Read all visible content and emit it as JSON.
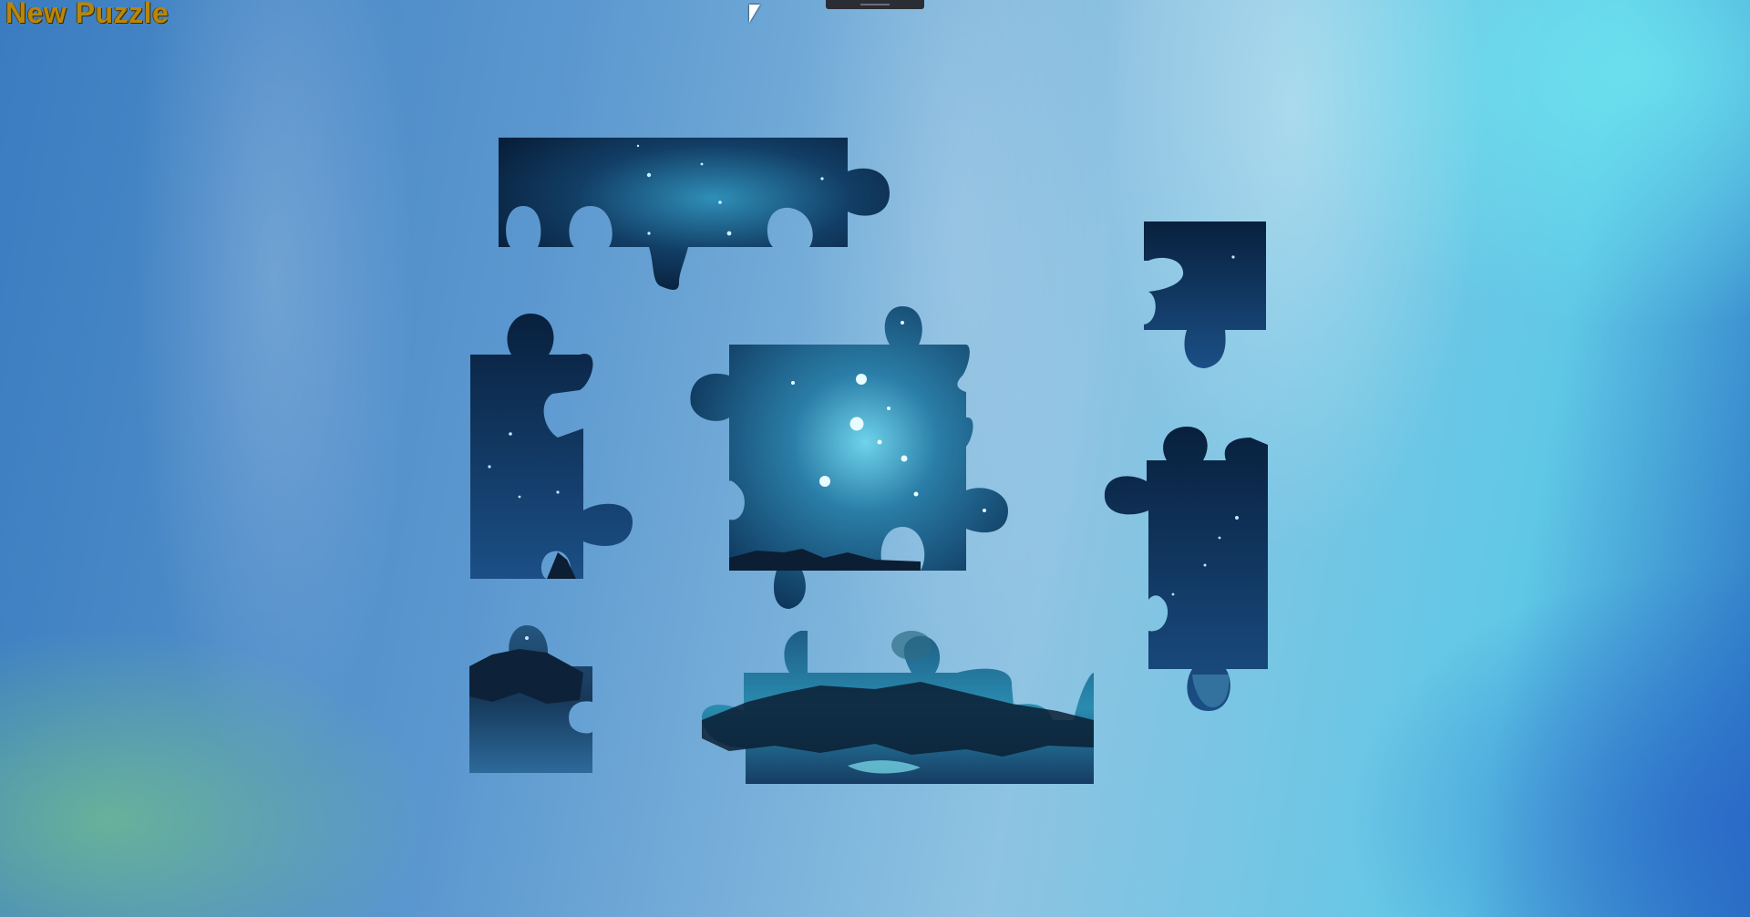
{
  "app": {
    "title": "New Puzzle"
  },
  "colors": {
    "title": "#b8860b",
    "sky_dark": "#071a33",
    "sky_mid": "#14507a",
    "sky_glow": "#4fc0e0",
    "rock": "#0e2238"
  },
  "icons": {
    "cursor": "mouse-pointer-icon",
    "handle": "drag-handle-icon"
  }
}
